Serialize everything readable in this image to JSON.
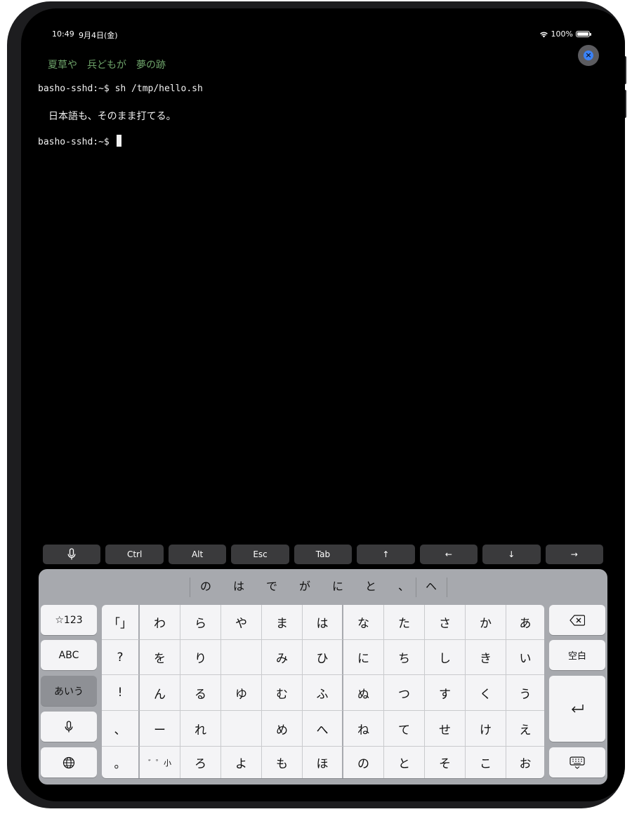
{
  "status": {
    "time": "10:49",
    "date": "9月4日(金)",
    "battery": "100%"
  },
  "terminal": {
    "haiku": "夏草や　兵どもが　夢の跡",
    "line1": "basho-sshd:~$ sh /tmp/hello.sh",
    "output": "日本語も、そのまま打てる。",
    "prompt": "basho-sshd:~$ "
  },
  "accessory_bar": {
    "ctrl": "Ctrl",
    "alt": "Alt",
    "esc": "Esc",
    "tab": "Tab",
    "up": "↑",
    "left": "←",
    "down": "↓",
    "right": "→",
    "mic_icon": "microphone-icon"
  },
  "candidates": [
    "の",
    "は",
    "で",
    "が",
    "に",
    "と",
    "、",
    "ヘ"
  ],
  "keyboard": {
    "left": {
      "sym": "☆123",
      "abc": "ABC",
      "kana": "あいう",
      "mic": "microphone-icon",
      "globe": "globe-icon"
    },
    "right": {
      "backspace": "delete-icon",
      "space": "空白",
      "return": "return-icon",
      "hide": "keyboard-hide-icon"
    },
    "col0": [
      "「」",
      "?",
      "!",
      "、",
      "。"
    ],
    "rows": [
      [
        "わ",
        "ら",
        "や",
        "ま",
        "は",
        "な",
        "た",
        "さ",
        "か",
        "あ"
      ],
      [
        "を",
        "り",
        "",
        "み",
        "ひ",
        "に",
        "ち",
        "し",
        "き",
        "い"
      ],
      [
        "ん",
        "る",
        "ゆ",
        "む",
        "ふ",
        "ぬ",
        "つ",
        "す",
        "く",
        "う"
      ],
      [
        "ー",
        "れ",
        "",
        "め",
        "へ",
        "ね",
        "て",
        "せ",
        "け",
        "え"
      ],
      [
        "゛゜小",
        "ろ",
        "よ",
        "も",
        "ほ",
        "の",
        "と",
        "そ",
        "こ",
        "お"
      ]
    ]
  }
}
